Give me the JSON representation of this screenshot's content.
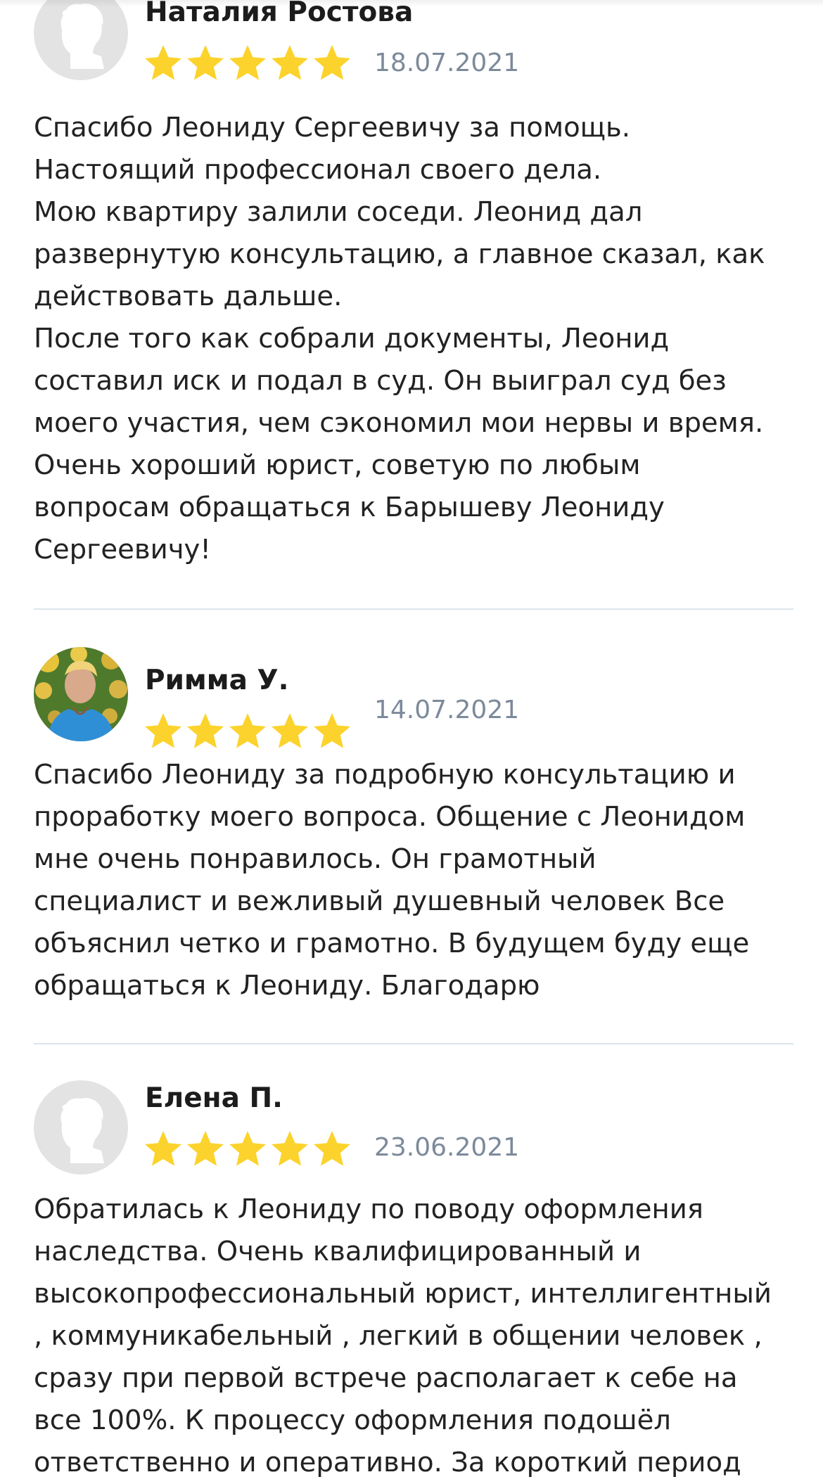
{
  "reviews": [
    {
      "name": "Наталия Ростова",
      "rating": 5,
      "date": "18.07.2021",
      "avatar": "default-person-icon",
      "lines": [
        "Спасибо Леониду Сергеевичу за помощь.",
        "Настоящий профессионал своего дела.",
        "Мою квартиру залили соседи. Леонид дал",
        "развернутую консультацию, а главное сказал, как",
        "действовать дальше.",
        "После того как собрали документы, Леонид",
        "составил иск и подал в суд. Он выиграл суд без",
        "моего участия, чем сэкономил мои нервы и время.",
        "Очень хороший юрист, советую по любым",
        "вопросам обращаться к Барышеву Леониду",
        "Сергеевичу!"
      ]
    },
    {
      "name": "Римма У.",
      "rating": 5,
      "date": "14.07.2021",
      "avatar": "user-photo",
      "lines": [
        "Спасибо Леониду за подробную консультацию и",
        "проработку моего вопроса. Общение с Леонидом",
        "мне очень понравилось. Он грамотный",
        "специалист и вежливый душевный человек Все",
        "объяснил четко и грамотно. В будущем буду еще",
        "обращаться к Леониду. Благодарю"
      ]
    },
    {
      "name": "Елена П.",
      "rating": 5,
      "date": "23.06.2021",
      "avatar": "default-person-icon",
      "lines": [
        "Обратилась к Леониду по поводу оформления",
        "наследства. Очень квалифицированный и",
        "высокопрофессиональный юрист, интеллигентный",
        ", коммуникабельный , легкий в общении человек ,",
        "сразу при первой встрече располагает к себе на",
        "все 100%. К процессу оформления подошёл",
        "ответственно и оперативно. За короткий период"
      ]
    }
  ],
  "colors": {
    "star": "#FCD32C",
    "date": "#7C8A9A",
    "divider": "#DDE5EA",
    "avatar_bg": "#E3E3E3",
    "avatar_figure": "#FFFFFF"
  }
}
